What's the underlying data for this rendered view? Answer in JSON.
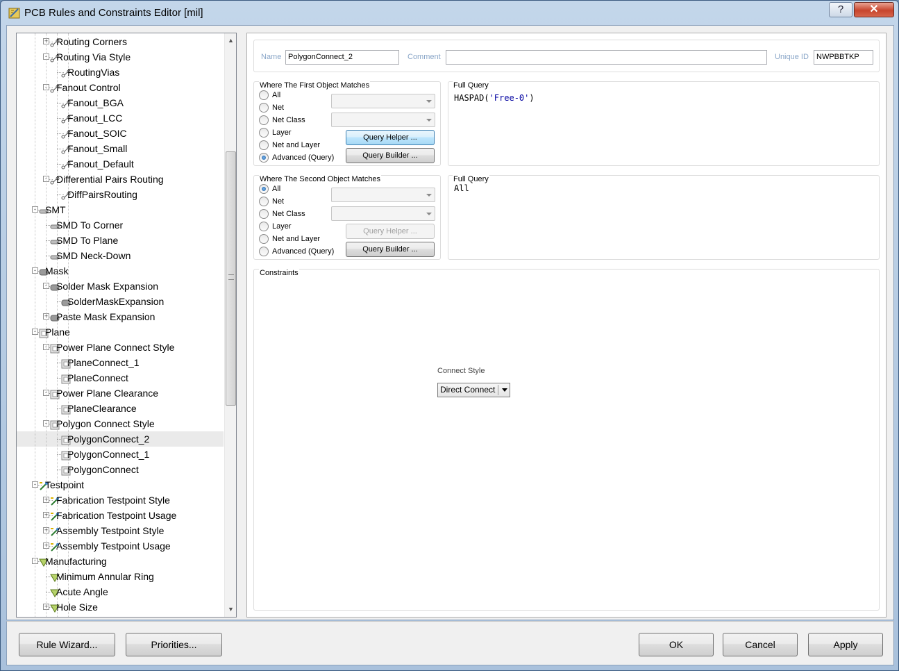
{
  "window": {
    "title": "PCB Rules and Constraints Editor [mil]",
    "help_label": "?",
    "close_label": "✕"
  },
  "tree": {
    "items": [
      {
        "label": "Routing Corners",
        "level": 2,
        "icon": "routing-icon",
        "expander": "+"
      },
      {
        "label": "Routing Via Style",
        "level": 2,
        "icon": "routing-icon",
        "expander": "-"
      },
      {
        "label": "RoutingVias",
        "level": 3,
        "icon": "routing-icon",
        "expander": ""
      },
      {
        "label": "Fanout Control",
        "level": 2,
        "icon": "routing-icon",
        "expander": "-"
      },
      {
        "label": "Fanout_BGA",
        "level": 3,
        "icon": "routing-icon",
        "expander": ""
      },
      {
        "label": "Fanout_LCC",
        "level": 3,
        "icon": "routing-icon",
        "expander": ""
      },
      {
        "label": "Fanout_SOIC",
        "level": 3,
        "icon": "routing-icon",
        "expander": ""
      },
      {
        "label": "Fanout_Small",
        "level": 3,
        "icon": "routing-icon",
        "expander": ""
      },
      {
        "label": "Fanout_Default",
        "level": 3,
        "icon": "routing-icon",
        "expander": ""
      },
      {
        "label": "Differential Pairs Routing",
        "level": 2,
        "icon": "routing-icon",
        "expander": "-"
      },
      {
        "label": "DiffPairsRouting",
        "level": 3,
        "icon": "routing-icon",
        "expander": ""
      },
      {
        "label": "SMT",
        "level": 1,
        "icon": "smt-icon",
        "expander": "-"
      },
      {
        "label": "SMD To Corner",
        "level": 2,
        "icon": "smt-icon",
        "expander": ""
      },
      {
        "label": "SMD To Plane",
        "level": 2,
        "icon": "smt-icon",
        "expander": ""
      },
      {
        "label": "SMD Neck-Down",
        "level": 2,
        "icon": "smt-icon",
        "expander": ""
      },
      {
        "label": "Mask",
        "level": 1,
        "icon": "mask-icon",
        "expander": "-"
      },
      {
        "label": "Solder Mask Expansion",
        "level": 2,
        "icon": "mask-icon",
        "expander": "-"
      },
      {
        "label": "SolderMaskExpansion",
        "level": 3,
        "icon": "mask-icon",
        "expander": ""
      },
      {
        "label": "Paste Mask Expansion",
        "level": 2,
        "icon": "mask-icon",
        "expander": "+"
      },
      {
        "label": "Plane",
        "level": 1,
        "icon": "plane-icon",
        "expander": "-"
      },
      {
        "label": "Power Plane Connect Style",
        "level": 2,
        "icon": "plane-icon",
        "expander": "-"
      },
      {
        "label": "PlaneConnect_1",
        "level": 3,
        "icon": "plane-icon",
        "expander": ""
      },
      {
        "label": "PlaneConnect",
        "level": 3,
        "icon": "plane-icon",
        "expander": ""
      },
      {
        "label": "Power Plane Clearance",
        "level": 2,
        "icon": "plane-icon",
        "expander": "-"
      },
      {
        "label": "PlaneClearance",
        "level": 3,
        "icon": "plane-icon",
        "expander": ""
      },
      {
        "label": "Polygon Connect Style",
        "level": 2,
        "icon": "plane-icon",
        "expander": "-"
      },
      {
        "label": "PolygonConnect_2",
        "level": 3,
        "icon": "plane-icon",
        "expander": "",
        "selected": true
      },
      {
        "label": "PolygonConnect_1",
        "level": 3,
        "icon": "plane-icon",
        "expander": ""
      },
      {
        "label": "PolygonConnect",
        "level": 3,
        "icon": "plane-icon",
        "expander": ""
      },
      {
        "label": "Testpoint",
        "level": 1,
        "icon": "testpoint-icon",
        "expander": "-"
      },
      {
        "label": "Fabrication Testpoint Style",
        "level": 2,
        "icon": "testpoint-icon",
        "expander": "+"
      },
      {
        "label": "Fabrication Testpoint Usage",
        "level": 2,
        "icon": "testpoint-icon",
        "expander": "+"
      },
      {
        "label": "Assembly Testpoint Style",
        "level": 2,
        "icon": "testpoint-icon",
        "expander": "+"
      },
      {
        "label": "Assembly Testpoint Usage",
        "level": 2,
        "icon": "testpoint-icon",
        "expander": "+"
      },
      {
        "label": "Manufacturing",
        "level": 1,
        "icon": "manufacturing-icon",
        "expander": "-"
      },
      {
        "label": "Minimum Annular Ring",
        "level": 2,
        "icon": "manufacturing-icon",
        "expander": ""
      },
      {
        "label": "Acute Angle",
        "level": 2,
        "icon": "manufacturing-icon",
        "expander": ""
      },
      {
        "label": "Hole Size",
        "level": 2,
        "icon": "manufacturing-icon",
        "expander": "+"
      }
    ]
  },
  "rule": {
    "name_label": "Name",
    "name_value": "PolygonConnect_2",
    "comment_label": "Comment",
    "comment_value": "",
    "uid_label": "Unique ID",
    "uid_value": "NWPBBTKP"
  },
  "first_match": {
    "title": "Where The First Object Matches",
    "options": [
      "All",
      "Net",
      "Net Class",
      "Layer",
      "Net and Layer",
      "Advanced (Query)"
    ],
    "selected": "Advanced (Query)",
    "query_helper": "Query Helper ...",
    "query_builder": "Query Builder ...",
    "full_query_title": "Full Query",
    "full_query_fn": "HASPAD(",
    "full_query_arg": "'Free-0'",
    "full_query_close": ")"
  },
  "second_match": {
    "title": "Where The Second Object Matches",
    "options": [
      "All",
      "Net",
      "Net Class",
      "Layer",
      "Net and Layer",
      "Advanced (Query)"
    ],
    "selected": "All",
    "query_helper": "Query Helper ...",
    "query_builder": "Query Builder ...",
    "full_query_title": "Full Query",
    "full_query": "All"
  },
  "constraints": {
    "title": "Constraints",
    "connect_style_label": "Connect Style",
    "connect_style_value": "Direct Connect"
  },
  "footer": {
    "rule_wizard": "Rule Wizard...",
    "priorities": "Priorities...",
    "ok": "OK",
    "cancel": "Cancel",
    "apply": "Apply"
  }
}
